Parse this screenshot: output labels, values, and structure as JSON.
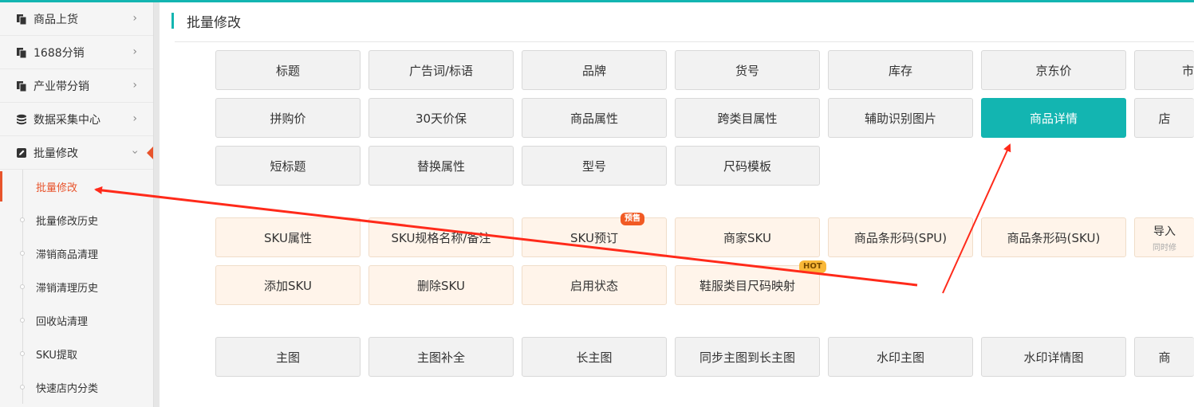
{
  "sidebar": {
    "items": [
      {
        "label": "商品上货",
        "icon": "copy-icon"
      },
      {
        "label": "1688分销",
        "icon": "copy-icon"
      },
      {
        "label": "产业带分销",
        "icon": "copy-icon"
      },
      {
        "label": "数据采集中心",
        "icon": "database-icon"
      },
      {
        "label": "批量修改",
        "icon": "edit-icon"
      }
    ],
    "submenu": [
      {
        "label": "批量修改"
      },
      {
        "label": "批量修改历史"
      },
      {
        "label": "滞销商品清理"
      },
      {
        "label": "滞销清理历史"
      },
      {
        "label": "回收站清理"
      },
      {
        "label": "SKU提取"
      },
      {
        "label": "快速店内分类"
      }
    ],
    "arrow": "›"
  },
  "main": {
    "title": "批量修改",
    "group1": [
      {
        "label": "标题"
      },
      {
        "label": "广告词/标语"
      },
      {
        "label": "品牌"
      },
      {
        "label": "货号"
      },
      {
        "label": "库存"
      },
      {
        "label": "京东价"
      },
      {
        "label": "市"
      },
      {
        "label": "拼购价"
      },
      {
        "label": "30天价保"
      },
      {
        "label": "商品属性"
      },
      {
        "label": "跨类目属性"
      },
      {
        "label": "辅助识别图片"
      },
      {
        "label": "商品详情"
      },
      {
        "label": "店"
      },
      {
        "label": "短标题"
      },
      {
        "label": "替换属性"
      },
      {
        "label": "型号"
      },
      {
        "label": "尺码模板"
      }
    ],
    "group2": [
      {
        "label": "SKU属性"
      },
      {
        "label": "SKU规格名称/备注"
      },
      {
        "label": "SKU预订"
      },
      {
        "label": "商家SKU"
      },
      {
        "label": "商品条形码(SPU)"
      },
      {
        "label": "商品条形码(SKU)"
      },
      {
        "label": "导入",
        "sub": "同时修"
      },
      {
        "label": "添加SKU"
      },
      {
        "label": "删除SKU"
      },
      {
        "label": "启用状态"
      },
      {
        "label": "鞋服类目尺码映射"
      }
    ],
    "group3": [
      {
        "label": "主图"
      },
      {
        "label": "主图补全"
      },
      {
        "label": "长主图"
      },
      {
        "label": "同步主图到长主图"
      },
      {
        "label": "水印主图"
      },
      {
        "label": "水印详情图"
      },
      {
        "label": "商"
      }
    ],
    "badges": {
      "presale": "预售",
      "hot": "HOT"
    }
  },
  "colors": {
    "accent": "#13b5b1",
    "active": "#e8542c",
    "annotation": "#ff2a1a"
  }
}
